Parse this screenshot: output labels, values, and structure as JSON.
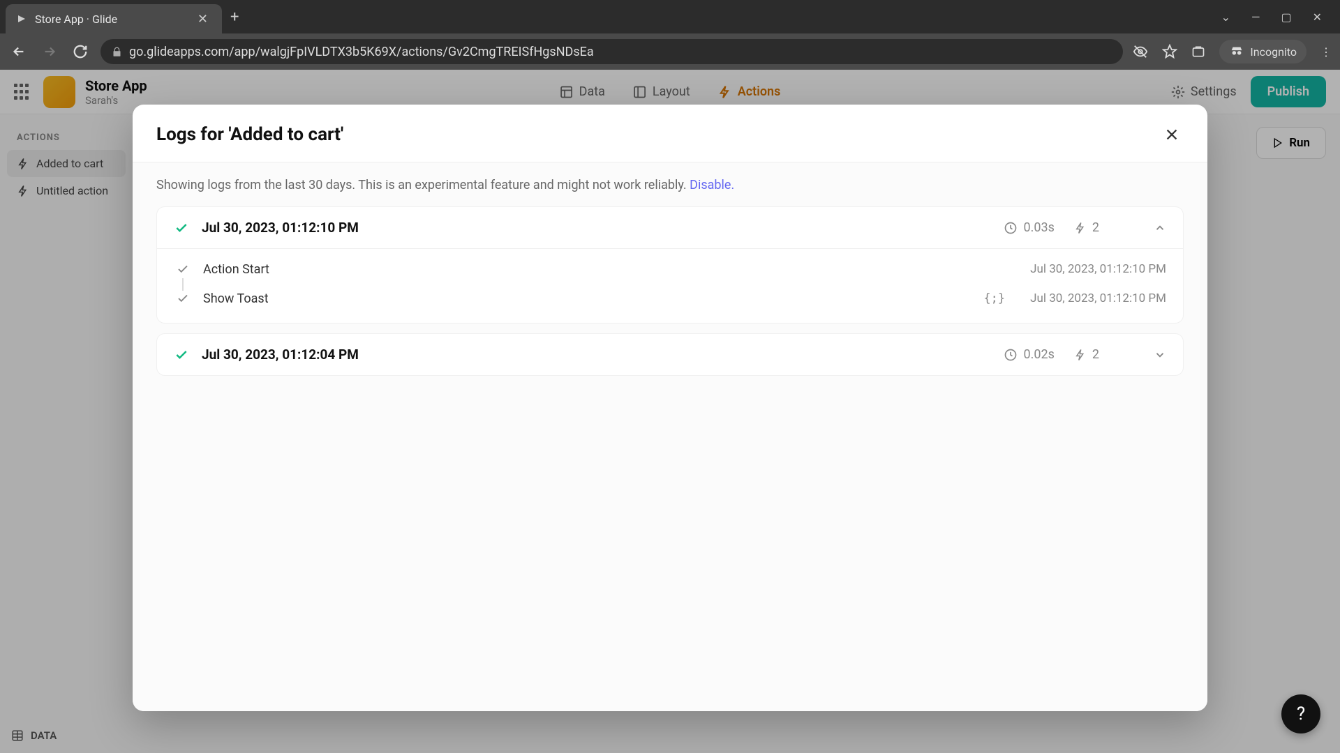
{
  "browser": {
    "tab_title": "Store App · Glide",
    "url": "go.glideapps.com/app/walgjFpIVLDTX3b5K69X/actions/Gv2CmgTREISfHgsNDsEa",
    "incognito_label": "Incognito"
  },
  "app": {
    "title": "Store App",
    "subtitle": "Sarah's",
    "nav": {
      "data": "Data",
      "layout": "Layout",
      "actions": "Actions"
    },
    "settings_label": "Settings",
    "publish_label": "Publish",
    "run_label": "Run"
  },
  "sidebar": {
    "heading": "ACTIONS",
    "items": [
      {
        "label": "Added to cart"
      },
      {
        "label": "Untitled action"
      }
    ],
    "data_label": "DATA"
  },
  "modal": {
    "title": "Logs for 'Added to cart'",
    "banner_prefix": "Showing logs from the last 30 days. This is an experimental feature and might not work reliably. ",
    "banner_link": "Disable."
  },
  "logs": [
    {
      "timestamp": "Jul 30, 2023, 01:12:10 PM",
      "duration": "0.03s",
      "action_count": "2",
      "expanded": true,
      "steps": [
        {
          "name": "Action Start",
          "time": "Jul 30, 2023, 01:12:10 PM",
          "has_json": false
        },
        {
          "name": "Show Toast",
          "time": "Jul 30, 2023, 01:12:10 PM",
          "has_json": true
        }
      ]
    },
    {
      "timestamp": "Jul 30, 2023, 01:12:04 PM",
      "duration": "0.02s",
      "action_count": "2",
      "expanded": false
    }
  ]
}
